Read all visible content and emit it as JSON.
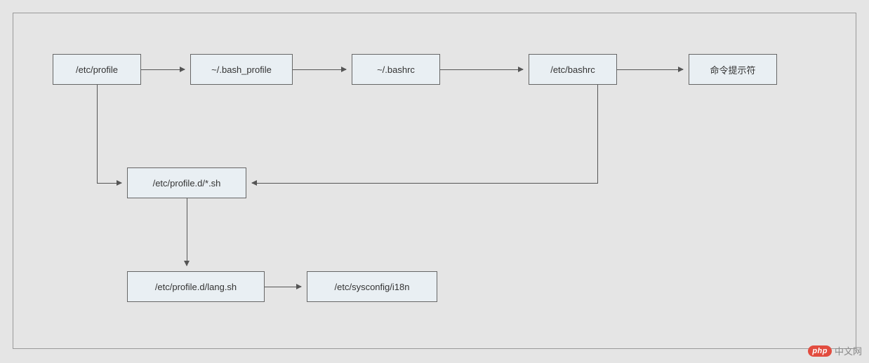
{
  "nodes": {
    "etc_profile": "/etc/profile",
    "bash_profile": "~/.bash_profile",
    "bashrc_user": "~/.bashrc",
    "etc_bashrc": "/etc/bashrc",
    "prompt": "命令提示符",
    "profile_d_sh": "/etc/profile.d/*.sh",
    "profile_d_lang": "/etc/profile.d/lang.sh",
    "sysconfig_i18n": "/etc/sysconfig/i18n"
  },
  "watermark": {
    "logo": "php",
    "text": "中文网"
  }
}
